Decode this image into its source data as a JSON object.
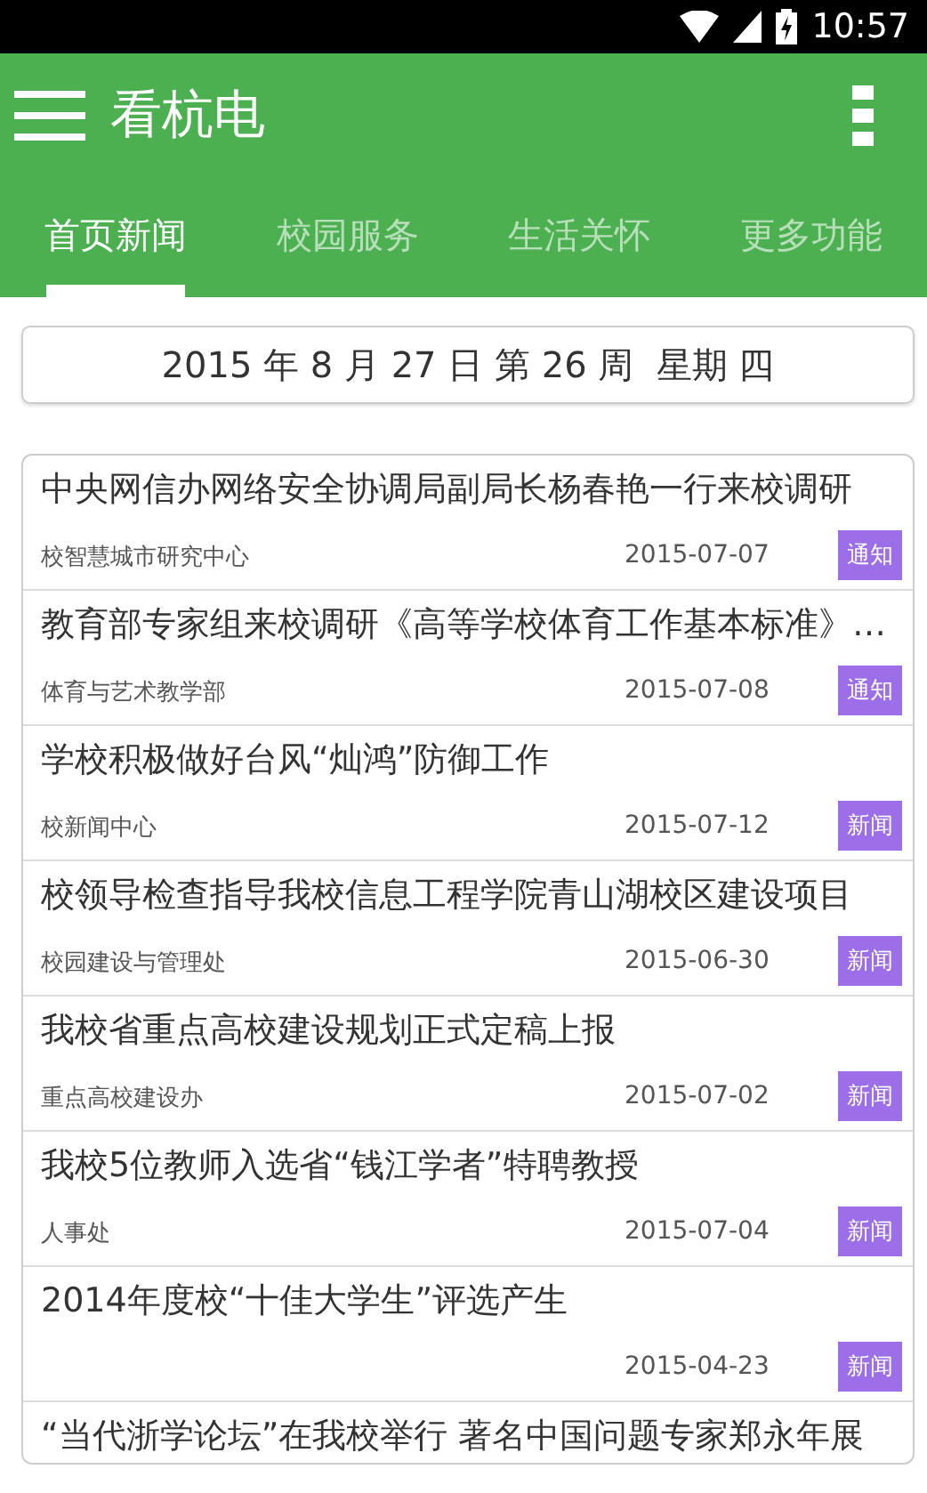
{
  "status_bar": {
    "time": "10:57"
  },
  "app_bar": {
    "title": "看杭电"
  },
  "tabs": [
    {
      "label": "首页新闻",
      "selected": true
    },
    {
      "label": "校园服务",
      "selected": false
    },
    {
      "label": "生活关怀",
      "selected": false
    },
    {
      "label": "更多功能",
      "selected": false
    }
  ],
  "date_banner": "2015 年 8 月 27 日 第 26 周  星期 四",
  "news": [
    {
      "title": "中央网信办网络安全协调局副局长杨春艳一行来校调研",
      "source": "校智慧城市研究中心",
      "date": "2015-07-07",
      "tag": "通知"
    },
    {
      "title": "教育部专家组来校调研《高等学校体育工作基本标准》…",
      "source": "体育与艺术教学部",
      "date": "2015-07-08",
      "tag": "通知"
    },
    {
      "title": "学校积极做好台风“灿鸿”防御工作",
      "source": "校新闻中心",
      "date": "2015-07-12",
      "tag": "新闻"
    },
    {
      "title": "校领导检查指导我校信息工程学院青山湖校区建设项目",
      "source": "校园建设与管理处",
      "date": "2015-06-30",
      "tag": "新闻"
    },
    {
      "title": "我校省重点高校建设规划正式定稿上报",
      "source": "重点高校建设办",
      "date": "2015-07-02",
      "tag": "新闻"
    },
    {
      "title": "我校5位教师入选省“钱江学者”特聘教授",
      "source": "人事处",
      "date": "2015-07-04",
      "tag": "新闻"
    },
    {
      "title": "2014年度校“十佳大学生”评选产生",
      "date": "2015-04-23",
      "tag": "新闻"
    },
    {
      "title": "“当代浙学论坛”在我校举行 著名中国问题专家郑永年展"
    }
  ]
}
